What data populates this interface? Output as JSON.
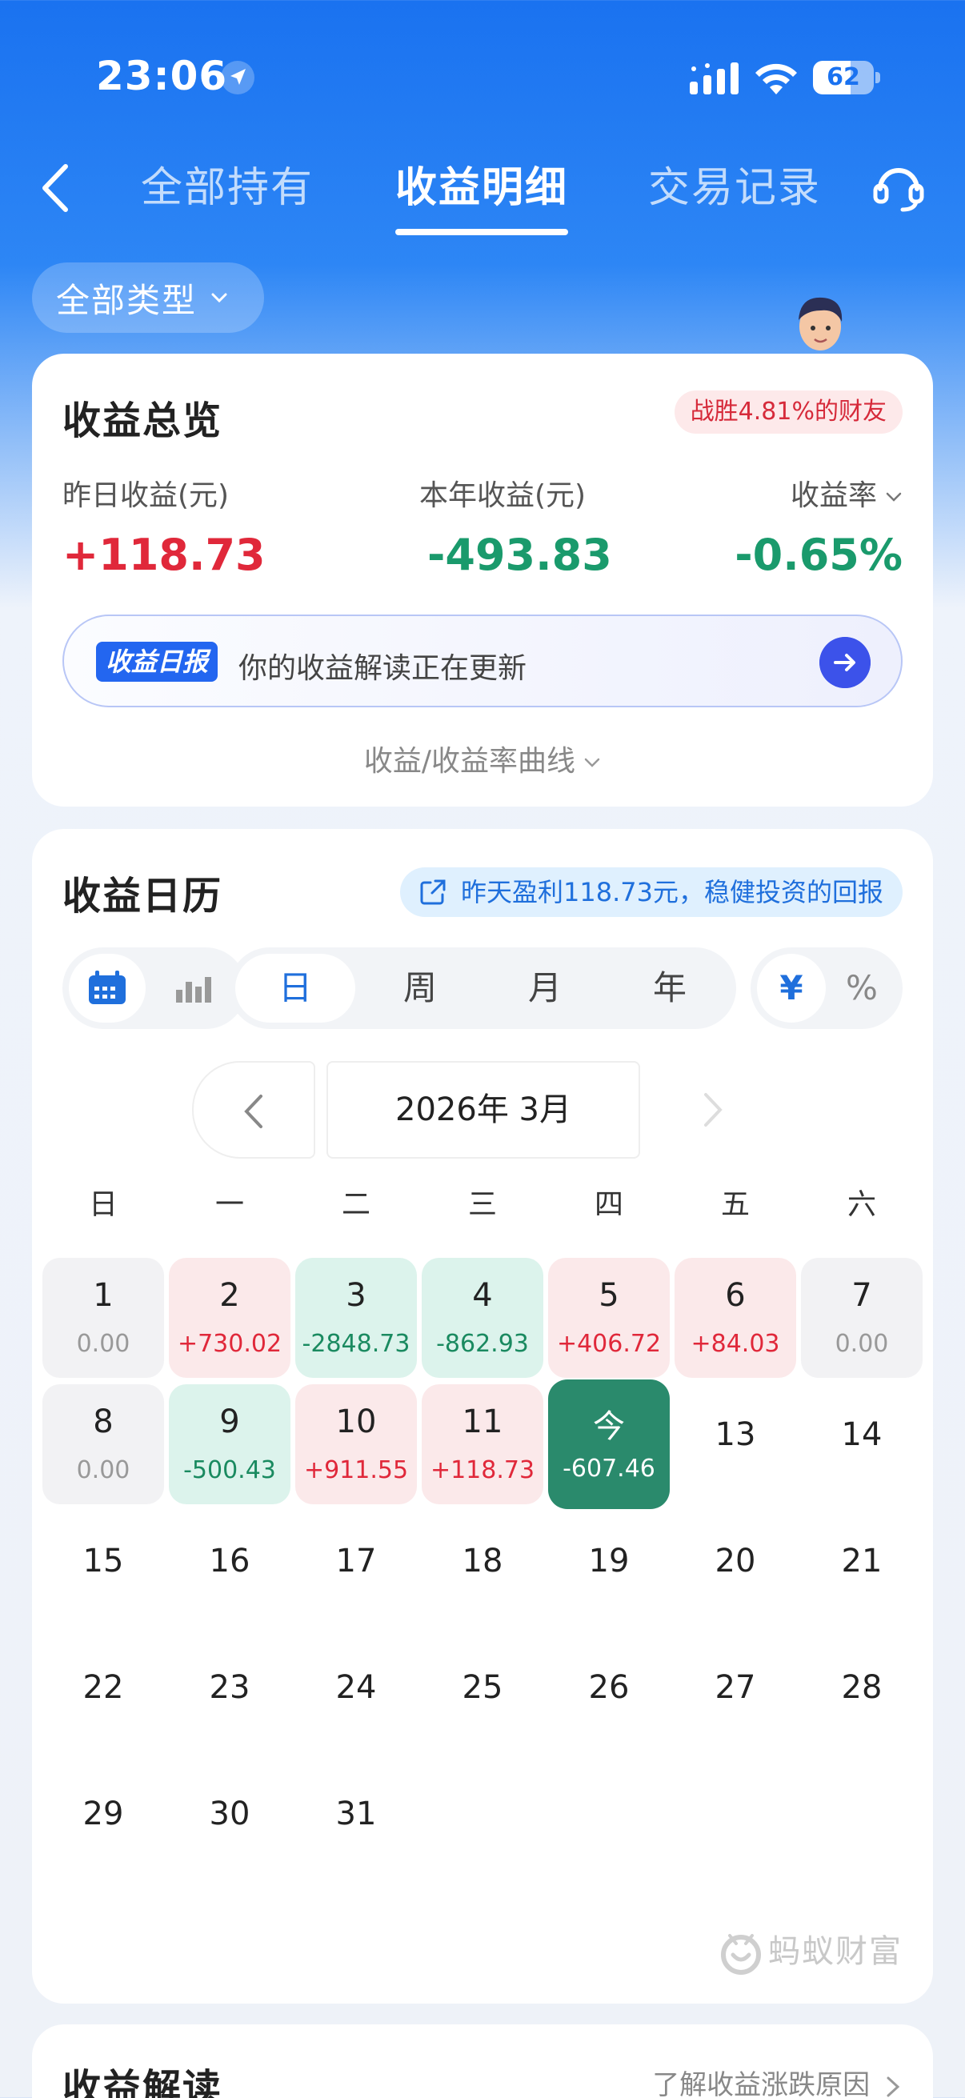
{
  "status": {
    "time": "23:06",
    "battery": "62"
  },
  "nav": {
    "tabs": [
      "全部持有",
      "收益明细",
      "交易记录"
    ],
    "active": 1
  },
  "filter": {
    "label": "全部类型"
  },
  "overview": {
    "title": "收益总览",
    "rank": "战胜4.81%的财友",
    "yesterday_label": "昨日收益(元)",
    "yesterday_value": "+118.73",
    "year_label": "本年收益(元)",
    "year_value": "-493.83",
    "rate_label": "收益率",
    "rate_value": "-0.65%",
    "daily_tag": "收益日报",
    "daily_text": "你的收益解读正在更新",
    "curve_link": "收益/收益率曲线"
  },
  "calendar": {
    "title": "收益日历",
    "hint": "昨天盈利118.73元，稳健投资的回报",
    "periods": [
      "日",
      "周",
      "月",
      "年"
    ],
    "active_period": "日",
    "units": [
      "¥",
      "%"
    ],
    "active_unit": "¥",
    "month": "2026年 3月",
    "weekdays": [
      "日",
      "一",
      "二",
      "三",
      "四",
      "五",
      "六"
    ],
    "days": [
      {
        "n": "1",
        "v": "0.00",
        "t": "gray"
      },
      {
        "n": "2",
        "v": "+730.02",
        "t": "pos"
      },
      {
        "n": "3",
        "v": "-2848.73",
        "t": "neg"
      },
      {
        "n": "4",
        "v": "-862.93",
        "t": "neg"
      },
      {
        "n": "5",
        "v": "+406.72",
        "t": "pos"
      },
      {
        "n": "6",
        "v": "+84.03",
        "t": "pos"
      },
      {
        "n": "7",
        "v": "0.00",
        "t": "gray"
      },
      {
        "n": "8",
        "v": "0.00",
        "t": "gray"
      },
      {
        "n": "9",
        "v": "-500.43",
        "t": "neg"
      },
      {
        "n": "10",
        "v": "+911.55",
        "t": "pos"
      },
      {
        "n": "11",
        "v": "+118.73",
        "t": "pos"
      },
      {
        "n": "今",
        "v": "-607.46",
        "t": "today"
      },
      {
        "n": "13",
        "v": "",
        "t": "plain"
      },
      {
        "n": "14",
        "v": "",
        "t": "plain"
      },
      {
        "n": "15",
        "v": "",
        "t": "plain"
      },
      {
        "n": "16",
        "v": "",
        "t": "plain"
      },
      {
        "n": "17",
        "v": "",
        "t": "plain"
      },
      {
        "n": "18",
        "v": "",
        "t": "plain"
      },
      {
        "n": "19",
        "v": "",
        "t": "plain"
      },
      {
        "n": "20",
        "v": "",
        "t": "plain"
      },
      {
        "n": "21",
        "v": "",
        "t": "plain"
      },
      {
        "n": "22",
        "v": "",
        "t": "plain"
      },
      {
        "n": "23",
        "v": "",
        "t": "plain"
      },
      {
        "n": "24",
        "v": "",
        "t": "plain"
      },
      {
        "n": "25",
        "v": "",
        "t": "plain"
      },
      {
        "n": "26",
        "v": "",
        "t": "plain"
      },
      {
        "n": "27",
        "v": "",
        "t": "plain"
      },
      {
        "n": "28",
        "v": "",
        "t": "plain"
      },
      {
        "n": "29",
        "v": "",
        "t": "plain"
      },
      {
        "n": "30",
        "v": "",
        "t": "plain"
      },
      {
        "n": "31",
        "v": "",
        "t": "plain"
      }
    ],
    "watermark": "蚂蚁财富"
  },
  "interpret": {
    "title": "收益解读",
    "link": "了解收益涨跌原因"
  },
  "colors": {
    "brand_blue": "#1a72f0",
    "gain_red": "#e0283a",
    "loss_green": "#1a9a6c"
  }
}
